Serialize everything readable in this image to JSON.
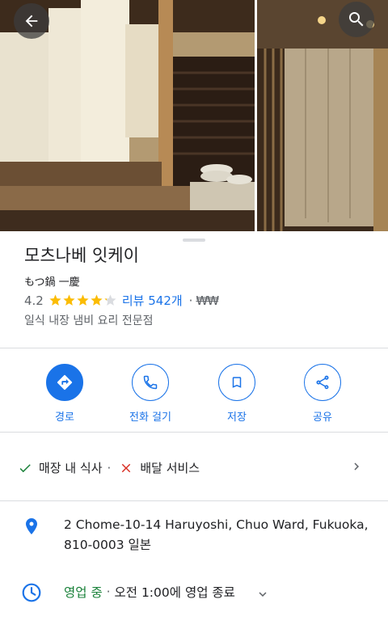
{
  "header": {
    "back_icon": "back-arrow-icon",
    "search_icon": "search-icon"
  },
  "place": {
    "name": "모츠나베 잇케이",
    "native_name": "もつ鍋 一慶",
    "rating": "4.2",
    "rating_value": 4.2,
    "reviews": "리뷰 542개",
    "separator": "·",
    "price": "₩₩",
    "category": "일식 내장 냄비 요리 전문점"
  },
  "actions": [
    {
      "label": "경로",
      "icon": "directions-icon"
    },
    {
      "label": "전화 걸기",
      "icon": "phone-icon"
    },
    {
      "label": "저장",
      "icon": "bookmark-icon"
    },
    {
      "label": "공유",
      "icon": "share-icon"
    }
  ],
  "services": {
    "dine_in": "매장 내 식사",
    "separator": "·",
    "delivery": "배달 서비스"
  },
  "address": {
    "text": "2 Chome-10-14 Haruyoshi, Chuo Ward, Fukuoka, 810-0003 일본"
  },
  "hours": {
    "status": "영업 중",
    "separator": " · ",
    "detail": "오전 1:00에 영업 종료"
  },
  "colors": {
    "accent": "#1a73e8",
    "star": "#fbbc04",
    "open": "#188038",
    "check": "#188038",
    "cross": "#d93025"
  }
}
